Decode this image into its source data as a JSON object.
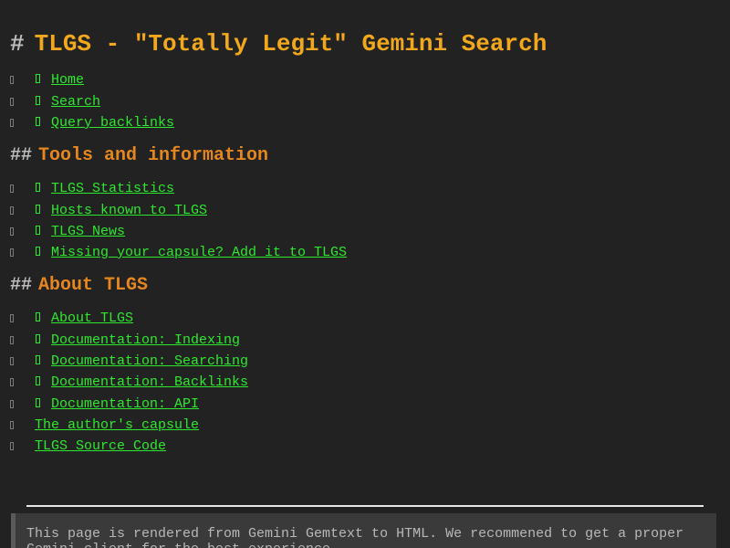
{
  "header": {
    "hash": "#",
    "title": "TLGS - \"Totally Legit\" Gemini Search"
  },
  "nav_links": [
    {
      "label": "Home",
      "icon": "gemini-link-icon"
    },
    {
      "label": "Search",
      "icon": "gemini-link-icon"
    },
    {
      "label": "Query backlinks",
      "icon": "gemini-link-icon"
    }
  ],
  "tools_section": {
    "hash": "##",
    "title": "Tools and information",
    "links": [
      {
        "label": "TLGS Statistics",
        "icon": "gemini-link-icon"
      },
      {
        "label": "Hosts known to TLGS",
        "icon": "gemini-link-icon"
      },
      {
        "label": "TLGS News",
        "icon": "gemini-link-icon"
      },
      {
        "label": "Missing your capsule? Add it to TLGS",
        "icon": "gemini-link-icon"
      }
    ]
  },
  "about_section": {
    "hash": "##",
    "title": "About TLGS",
    "links": [
      {
        "label": "About TLGS",
        "icon": "gemini-link-icon"
      },
      {
        "label": "Documentation: Indexing",
        "icon": "gemini-link-icon"
      },
      {
        "label": "Documentation: Searching",
        "icon": "gemini-link-icon"
      },
      {
        "label": "Documentation: Backlinks",
        "icon": "gemini-link-icon"
      },
      {
        "label": "Documentation: API",
        "icon": "gemini-link-icon"
      },
      {
        "label": "The author's capsule"
      },
      {
        "label": "TLGS Source Code"
      }
    ]
  },
  "footer": {
    "notice": "This page is rendered from Gemini Gemtext to HTML. We recommened to get a proper Gemini client for the best experience."
  },
  "colors": {
    "background": "#222222",
    "h1_title": "#f2a81d",
    "h2_title": "#e6861f",
    "link": "#2ee82e",
    "hash": "#bdbdbd",
    "notice_background": "#3a3a3a",
    "notice_text": "#b8b8b8"
  }
}
